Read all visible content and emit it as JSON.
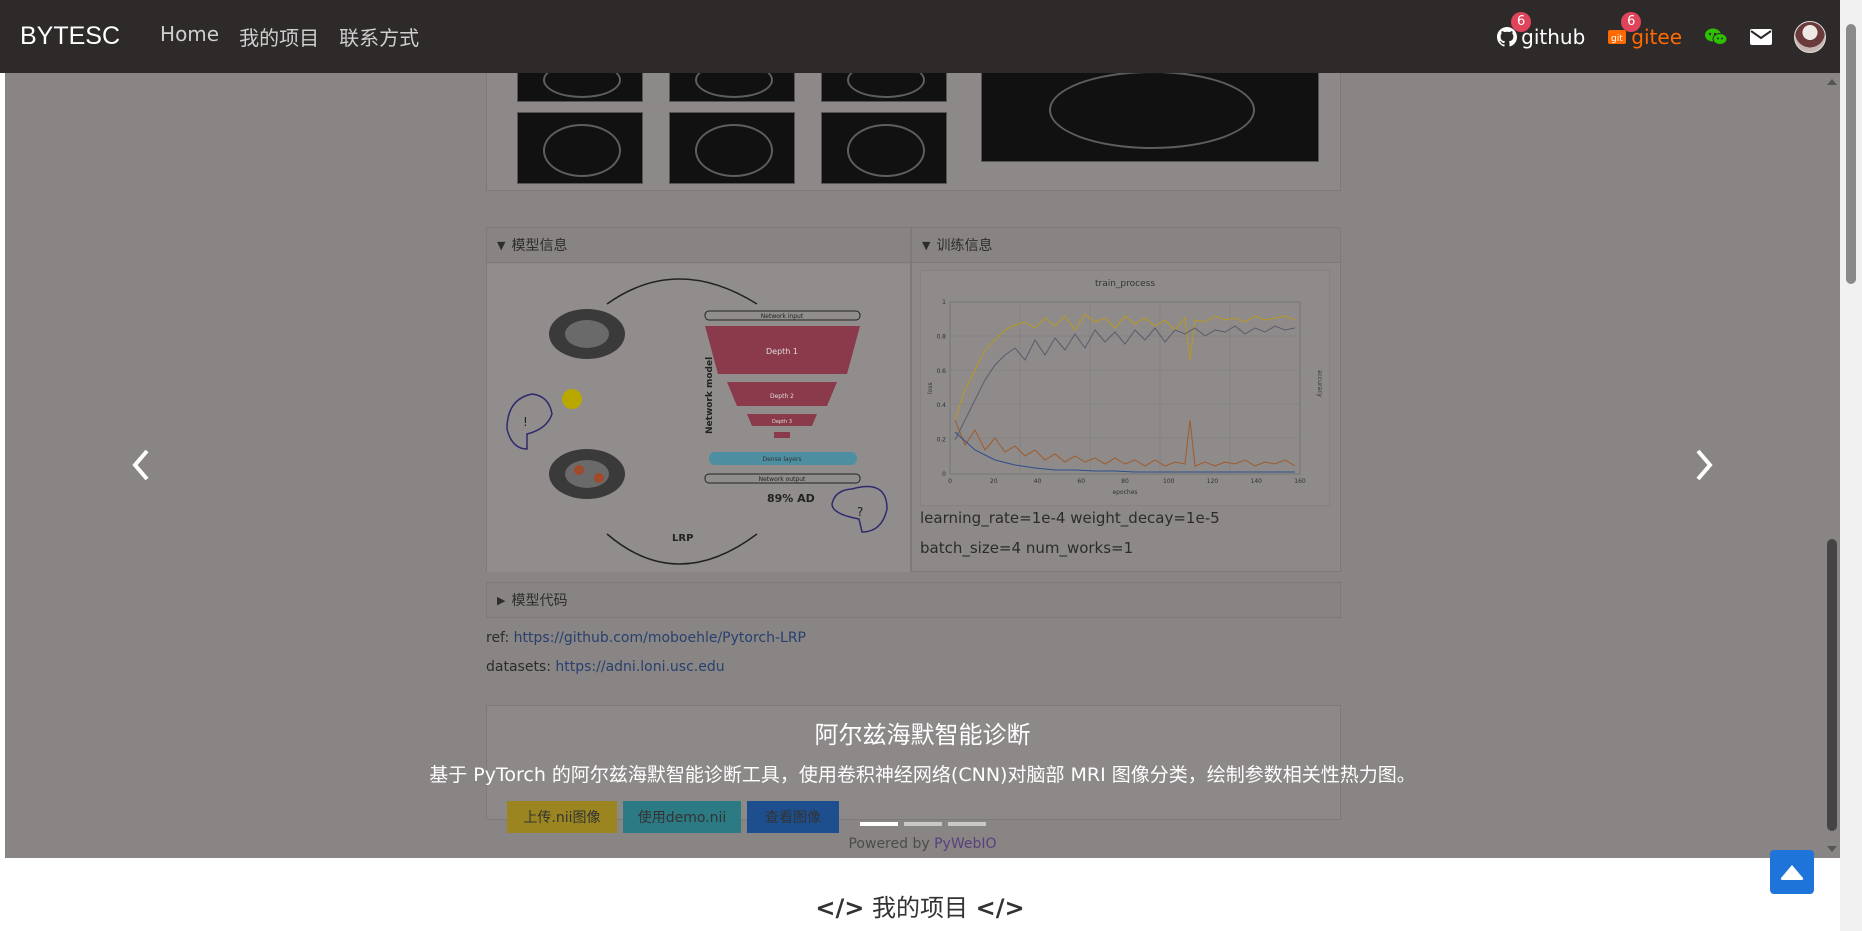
{
  "navbar": {
    "brand": "BYTESC",
    "links": [
      "Home",
      "我的项目",
      "联系方式"
    ],
    "github": {
      "label": "github",
      "count": "6"
    },
    "gitee": {
      "label": "gitee",
      "count": "6"
    }
  },
  "slide": {
    "panels": {
      "model_info": "模型信息",
      "train_info": "训练信息",
      "model_code": "模型代码"
    },
    "diagram": {
      "network_input": "Network input",
      "network_model": "Network model",
      "depth1": "Depth 1",
      "depth2": "Depth 2",
      "depth3": "Depth 3",
      "dense": "Dense layers",
      "network_output": "Network output",
      "lrp": "LRP",
      "result": "89% AD",
      "exclaim": "!",
      "question": "?"
    },
    "train_chart": {
      "title": "train_process",
      "xlabel": "epoches",
      "ylabel_left": "loss",
      "ylabel_right": "accuracy",
      "x_ticks": [
        "0",
        "20",
        "40",
        "60",
        "80",
        "100",
        "120",
        "140",
        "160"
      ],
      "y_ticks": [
        "0",
        "0.2",
        "0.4",
        "0.6",
        "0.8",
        "1"
      ]
    },
    "train_params1": "learning_rate=1e-4 weight_decay=1e-5",
    "train_params2": "batch_size=4 num_works=1",
    "ref_label": "ref:",
    "ref_url": "https://github.com/moboehle/Pytorch-LRP",
    "datasets_label": "datasets:",
    "datasets_url": "https://adni.loni.usc.edu",
    "buttons": [
      "上传.nii图像",
      "使用demo.nii",
      "查看图像"
    ],
    "powered_by": "Powered by",
    "pywebio": "PyWebIO"
  },
  "caption": {
    "title": "阿尔兹海默智能诊断",
    "text": "基于 PyTorch 的阿尔兹海默智能诊断工具，使用卷积神经网络(CNN)对脑部 MRI 图像分类，绘制参数相关性热力图。"
  },
  "section": {
    "title": "我的项目"
  },
  "colors": {
    "navbar": "#2e2a2a",
    "gitee": "#ff6a00",
    "wechat": "#2dc100",
    "badge": "#e0445b",
    "totop": "#1f74d9"
  }
}
